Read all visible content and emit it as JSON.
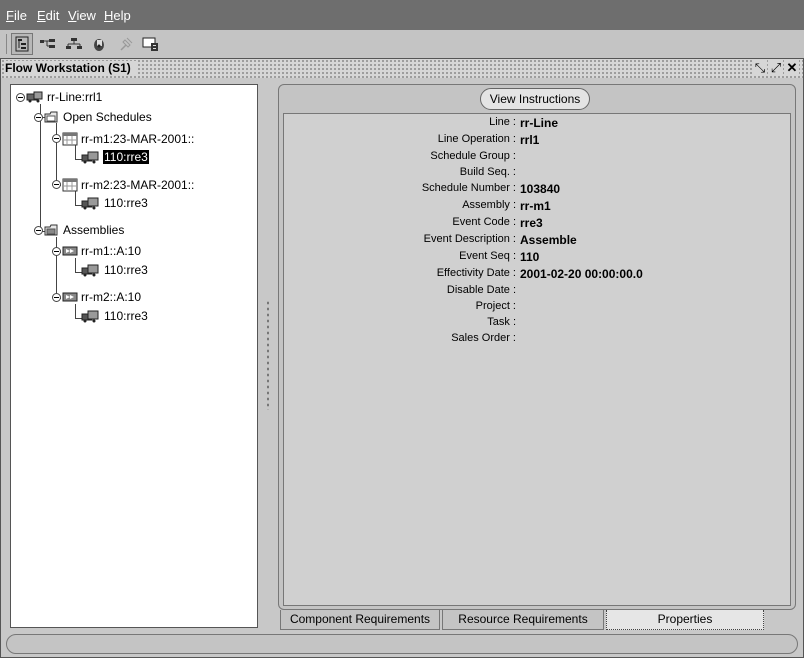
{
  "menu": [
    {
      "mnemonic": "F",
      "rest": "ile"
    },
    {
      "mnemonic": "E",
      "rest": "dit"
    },
    {
      "mnemonic": "V",
      "rest": "iew"
    },
    {
      "mnemonic": "H",
      "rest": "elp"
    }
  ],
  "toolbar": {
    "icons": [
      "tree-view-icon",
      "expand-icon",
      "hierarchy-icon",
      "lock-icon",
      "pin-icon",
      "export-icon"
    ]
  },
  "window": {
    "title": "Flow Workstation  (S1)",
    "controls": [
      "restore-icon",
      "maximize-icon",
      "close-icon"
    ]
  },
  "tree": {
    "root": "rr-Line:rrl1",
    "open_schedules": "Open Schedules",
    "sched1": "rr-m1:23-MAR-2001::",
    "sched1_op": "110:rre3",
    "sched2": "rr-m2:23-MAR-2001::",
    "sched2_op": "110:rre3",
    "assemblies": "Assemblies",
    "asm1": "rr-m1::A:10",
    "asm1_op": "110:rre3",
    "asm2": "rr-m2::A:10",
    "asm2_op": "110:rre3"
  },
  "view_instructions": "View Instructions",
  "properties": [
    {
      "label": "Line :",
      "value": "rr-Line"
    },
    {
      "label": "Line Operation :",
      "value": "rrl1"
    },
    {
      "label": "Schedule Group :",
      "value": ""
    },
    {
      "label": "Build Seq. :",
      "value": ""
    },
    {
      "label": "Schedule Number :",
      "value": "103840"
    },
    {
      "label": "Assembly :",
      "value": "rr-m1"
    },
    {
      "label": "Event Code :",
      "value": "rre3"
    },
    {
      "label": "Event Description :",
      "value": "Assemble"
    },
    {
      "label": "Event Seq :",
      "value": "110"
    },
    {
      "label": "Effectivity Date :",
      "value": "2001-02-20 00:00:00.0"
    },
    {
      "label": "Disable Date :",
      "value": ""
    },
    {
      "label": "Project :",
      "value": ""
    },
    {
      "label": "Task :",
      "value": ""
    },
    {
      "label": "Sales Order :",
      "value": ""
    }
  ],
  "tabs": [
    "Component Requirements",
    "Resource Requirements",
    "Properties"
  ],
  "active_tab": "Properties"
}
